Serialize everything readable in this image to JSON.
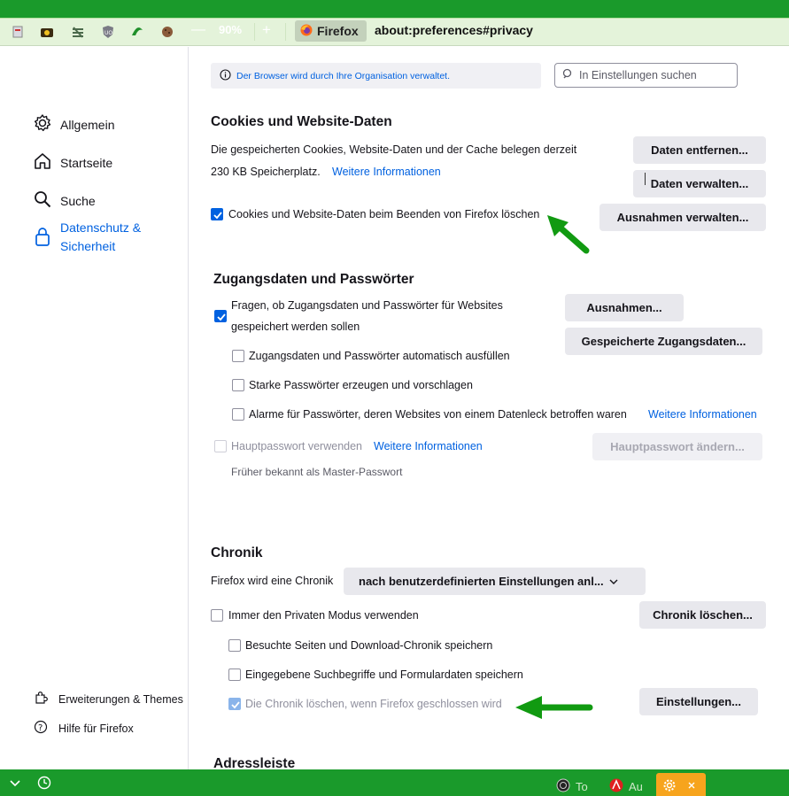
{
  "toolbar": {
    "zoom_minus": "—",
    "zoom_level": "90%",
    "zoom_plus": "+",
    "identity_label": "Firefox",
    "url": "about:preferences#privacy"
  },
  "sidebar": {
    "items": [
      {
        "label": "Allgemein",
        "icon": "gear-icon"
      },
      {
        "label": "Startseite",
        "icon": "home-icon"
      },
      {
        "label": "Suche",
        "icon": "search-icon"
      },
      {
        "label": "Datenschutz & Sicherheit",
        "icon": "lock-icon"
      }
    ],
    "footer": [
      {
        "label": "Erweiterungen & Themes",
        "icon": "puzzle-icon"
      },
      {
        "label": "Hilfe für Firefox",
        "icon": "help-icon"
      }
    ]
  },
  "notice": {
    "text": "Der Browser wird durch Ihre Organisation verwaltet."
  },
  "search": {
    "placeholder": "In Einstellungen suchen"
  },
  "cookies": {
    "heading": "Cookies und Website-Daten",
    "line1": "Die gespeicherten Cookies, Website-Daten und der Cache belegen derzeit",
    "line2": "230 KB Speicherplatz.",
    "more": "Weitere Informationen",
    "btn_clear": "Daten entfernen...",
    "btn_manage": "Daten verwalten...",
    "btn_exceptions": "Ausnahmen verwalten...",
    "cb_delete_on_close": "Cookies und Website-Daten beim Beenden von Firefox löschen"
  },
  "logins": {
    "heading": "Zugangsdaten und Passwörter",
    "cb_ask_line1": "Fragen, ob Zugangsdaten und Passwörter für Websites",
    "cb_ask_line2": "gespeichert werden sollen",
    "cb_autofill": "Zugangsdaten und Passwörter automatisch ausfüllen",
    "cb_generate": "Starke Passwörter erzeugen und vorschlagen",
    "cb_breach": "Alarme für Passwörter, deren Websites von einem Datenleck betroffen waren",
    "breach_more": "Weitere Informationen",
    "btn_exceptions": "Ausnahmen...",
    "btn_saved": "Gespeicherte Zugangsdaten...",
    "cb_primary": "Hauptpasswort verwenden",
    "primary_more": "Weitere Informationen",
    "btn_primary_change": "Hauptpasswort ändern...",
    "primary_note": "Früher bekannt als Master-Passwort"
  },
  "history": {
    "heading": "Chronik",
    "label": "Firefox wird eine Chronik",
    "select_value": "nach benutzerdefinierten Einstellungen anl...",
    "cb_private": "Immer den Privaten Modus verwenden",
    "btn_clear": "Chronik löschen...",
    "cb_visited": "Besuchte Seiten und Download-Chronik speichern",
    "cb_forms": "Eingegebene Suchbegriffe und Formulardaten speichern",
    "cb_clear_on_close": "Die Chronik löschen, wenn Firefox geschlossen wird",
    "btn_settings": "Einstellungen..."
  },
  "addressbar": {
    "heading": "Adressleiste"
  },
  "taskbar": {
    "items": [
      {
        "label": "To",
        "icon": "tor-icon"
      },
      {
        "label": "Au",
        "icon": "adobe-icon"
      }
    ]
  },
  "colors": {
    "accent": "#0061e0",
    "frame": "#1a9a2b",
    "arrow": "#119a11"
  }
}
